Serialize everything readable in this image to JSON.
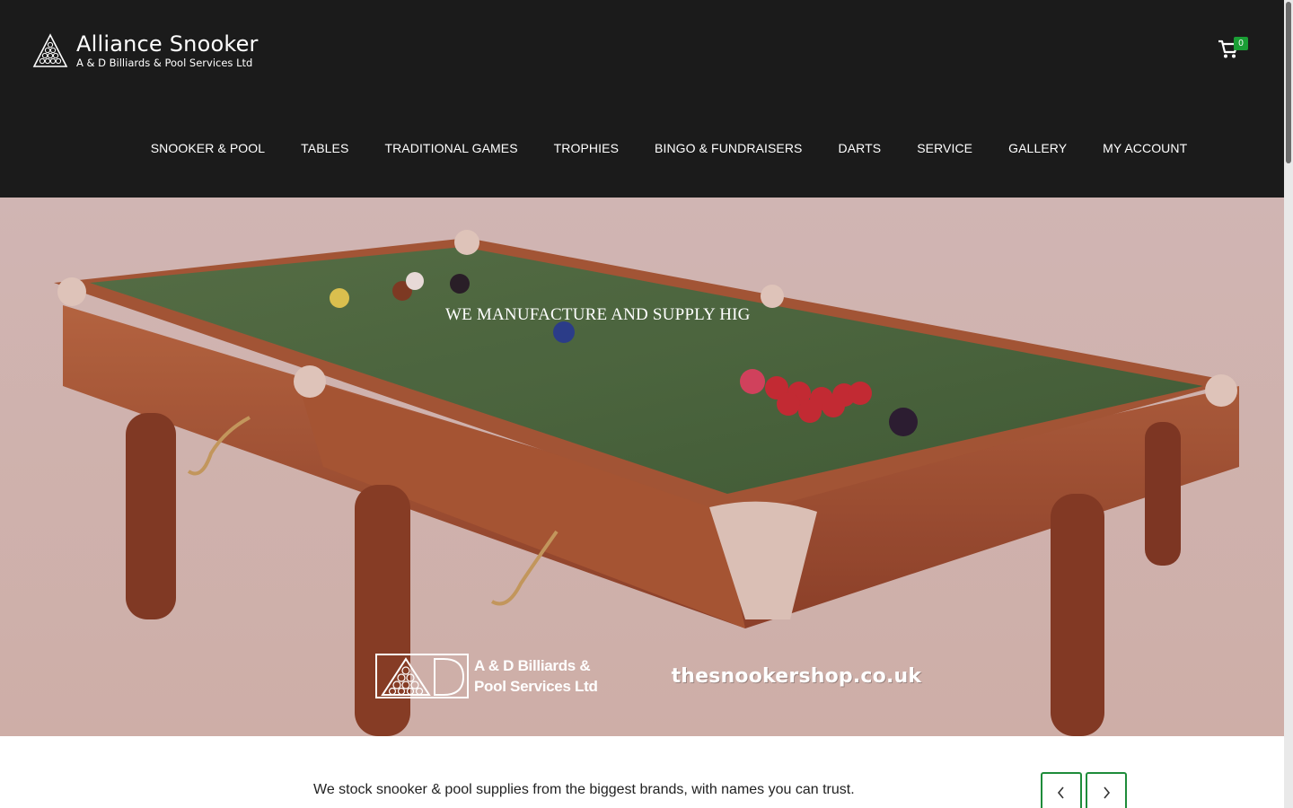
{
  "brand": {
    "title": "Alliance Snooker",
    "subtitle": "A & D Billiards & Pool Services Ltd",
    "logo_icon": "triangle-rack-icon"
  },
  "cart": {
    "icon": "shopping-cart-icon",
    "count": "0",
    "badge_color": "#1a9e35"
  },
  "nav": {
    "items": [
      {
        "label": "SNOOKER & POOL"
      },
      {
        "label": "TABLES"
      },
      {
        "label": "TRADITIONAL GAMES"
      },
      {
        "label": "TROPHIES"
      },
      {
        "label": "BINGO & FUNDRAISERS"
      },
      {
        "label": "DARTS"
      },
      {
        "label": "SERVICE"
      },
      {
        "label": "GALLERY"
      },
      {
        "label": "MY ACCOUNT"
      }
    ]
  },
  "hero": {
    "tagline": "WE MANUFACTURE AND SUPPLY HIG",
    "partner_logo_text_line1": "A & D Billiards &",
    "partner_logo_text_line2": "Pool Services Ltd",
    "shop_logo_text": "thesnookershop.co.uk"
  },
  "brands": {
    "text": "We stock snooker & pool supplies from the biggest brands, with names you can trust.",
    "prev_icon": "chevron-left-icon",
    "next_icon": "chevron-right-icon",
    "accent_color": "#1e8c3a"
  },
  "colors": {
    "header_bg": "#1b1b1b",
    "felt_green": "#3f6a34",
    "wood": "#9a4e26"
  }
}
